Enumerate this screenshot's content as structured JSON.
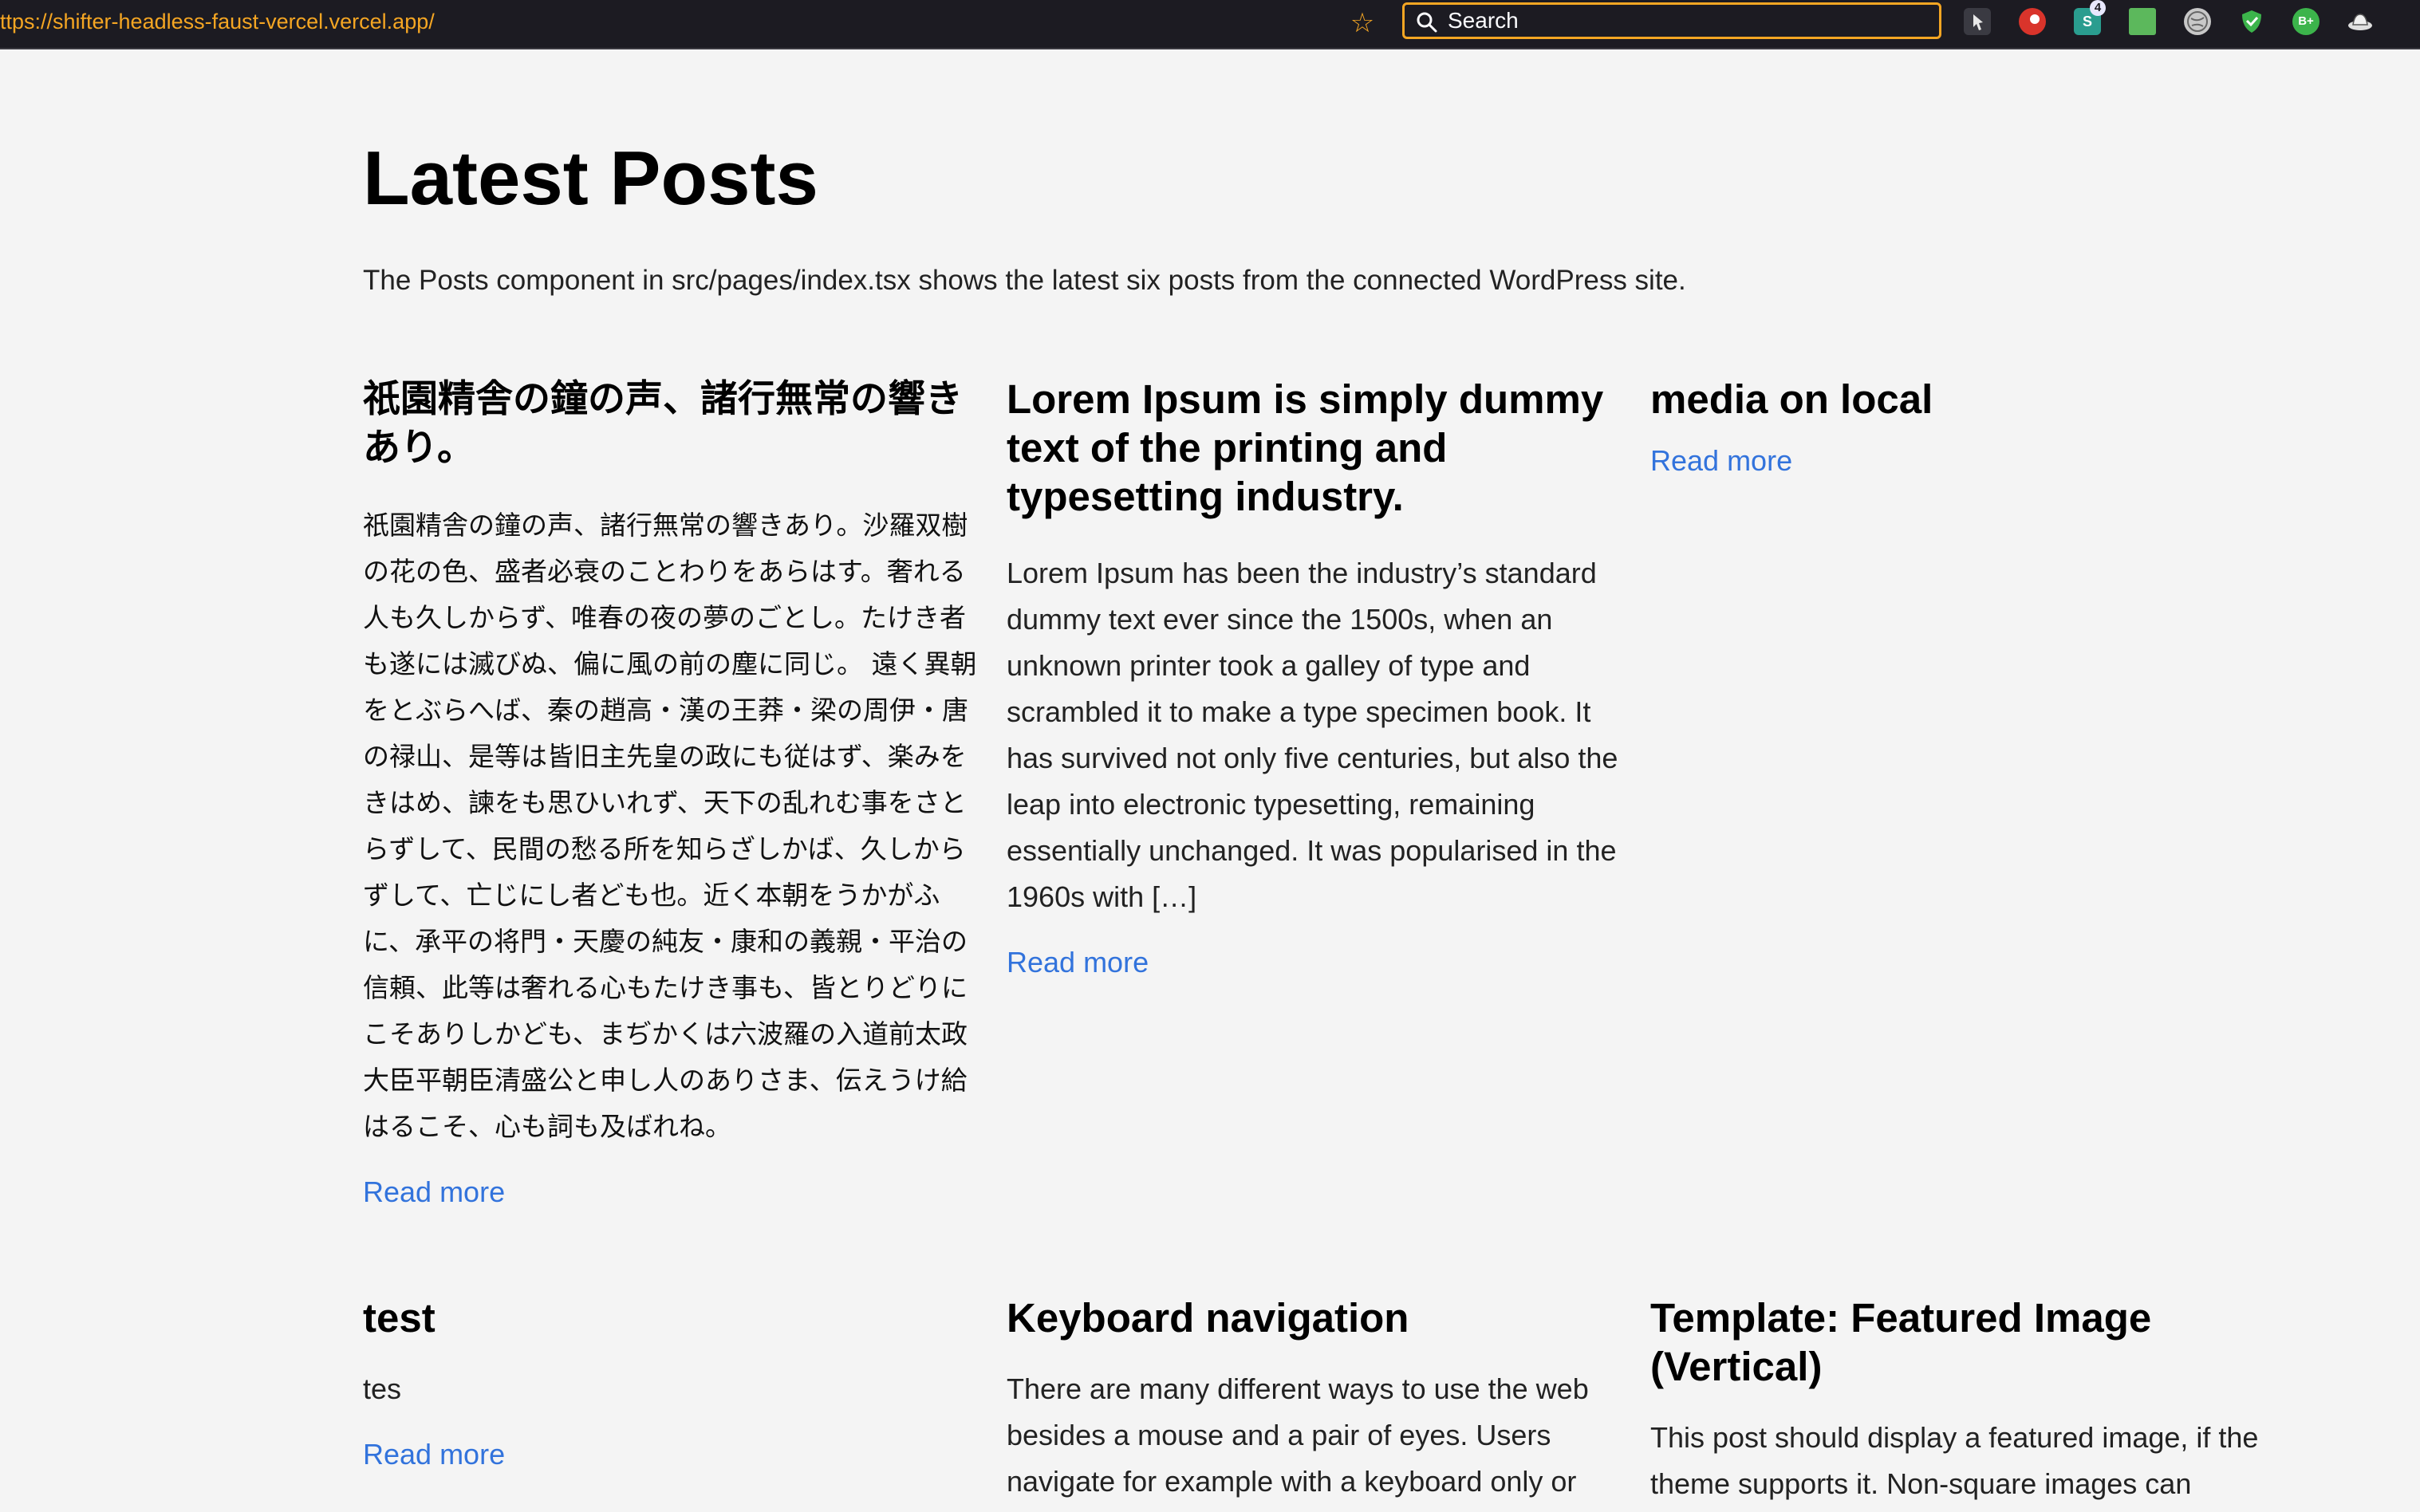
{
  "browser": {
    "url": "ttps://shifter-headless-faust-vercel.vercel.app/",
    "search_placeholder": "Search",
    "extension_badge_count": "4",
    "extension_b_plus_label": "B+"
  },
  "page": {
    "title": "Latest Posts",
    "intro": "The Posts component in src/pages/index.tsx shows the latest six posts from the connected WordPress site.",
    "read_more_label": "Read more"
  },
  "posts": [
    {
      "title": "祇園精舎の鐘の声、諸行無常の響きあり。",
      "excerpt": "祇園精舎の鐘の声、諸行無常の響きあり。沙羅双樹の花の色、盛者必衰のことわりをあらはす。奢れる人も久しからず、唯春の夜の夢のごとし。たけき者も遂には滅びぬ、偏に風の前の塵に同じ。 遠く異朝をとぶらへば、秦の趙高・漢の王莽・梁の周伊・唐の禄山、是等は皆旧主先皇の政にも従はず、楽みをきはめ、諫をも思ひいれず、天下の乱れむ事をさとらずして、民間の愁る所を知らざしかば、久しからずして、亡じにし者ども也。近く本朝をうかがふに、承平の将門・天慶の純友・康和の義親・平治の信頼、此等は奢れる心もたけき事も、皆とりどりにこそありしかども、まぢかくは六波羅の入道前太政大臣平朝臣清盛公と申し人のありさま、伝えうけ給はるこそ、心も詞も及ばれね。",
      "read_more": "Read more"
    },
    {
      "title": "Lorem Ipsum is simply dummy text of the printing and typesetting industry.",
      "excerpt": "Lorem Ipsum has been the industry’s standard dummy text ever since the 1500s, when an unknown printer took a galley of type and scrambled it to make a type specimen book. It has survived not only five centuries, but also the leap into electronic typesetting, remaining essentially unchanged. It was popularised in the 1960s with […]",
      "read_more": "Read more"
    },
    {
      "title": "media on local",
      "excerpt": "",
      "read_more": "Read more"
    },
    {
      "title": "test",
      "excerpt": "tes",
      "read_more": "Read more"
    },
    {
      "title": "Keyboard navigation",
      "excerpt": "There are many different ways to use the web besides a mouse and a pair of eyes. Users navigate for example with a keyboard only or",
      "read_more": ""
    },
    {
      "title": "Template: Featured Image (Vertical)",
      "excerpt": "This post should display a featured image, if the theme supports it. Non-square images can",
      "read_more": ""
    }
  ],
  "colors": {
    "background": "#f4f4f4",
    "toolbar": "#1c1b22",
    "accent_orange": "#f5a623",
    "link_blue": "#3273dc"
  },
  "icons": [
    "star-icon",
    "search-icon",
    "pin-extension-icon",
    "red-extension-icon",
    "s-extension-icon",
    "green-extension-icon",
    "globe-extension-icon",
    "shield-extension-icon",
    "b-plus-extension-icon",
    "hat-extension-icon"
  ]
}
